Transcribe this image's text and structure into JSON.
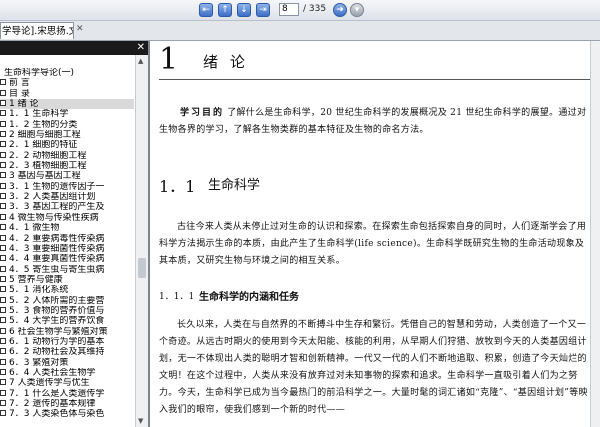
{
  "toolbar": {
    "page_value": "8",
    "page_total": "/ 335"
  },
  "tab": {
    "label": "学导论].宋思扬.文..."
  },
  "sidebar": {
    "items": [
      {
        "text": "生命科学导论(一)"
      },
      {
        "text": "前  言"
      },
      {
        "text": "目  录"
      },
      {
        "text": "1   绪  论"
      },
      {
        "text": "1．1  生命科学"
      },
      {
        "text": "1．2  生物的分类"
      },
      {
        "text": "2   细胞与细胞工程"
      },
      {
        "text": "2．1  细胞的特征"
      },
      {
        "text": "2．2  动物细胞工程"
      },
      {
        "text": "2．3  植物细胞工程"
      },
      {
        "text": "3   基因与基因工程"
      },
      {
        "text": "3．1  生物的遗传因子一"
      },
      {
        "text": "3．2  人类基因组计划"
      },
      {
        "text": "3．3  基因工程的产生及"
      },
      {
        "text": "4   微生物与传染性疾病"
      },
      {
        "text": "4．1  微生物"
      },
      {
        "text": "4．2  重要病毒性传染病"
      },
      {
        "text": "4．3  重要细菌性传染病"
      },
      {
        "text": "4．4  重要真菌性传染病"
      },
      {
        "text": "4．5  寄生虫与寄生虫病"
      },
      {
        "text": "5   营养与健康"
      },
      {
        "text": "5．1  消化系统"
      },
      {
        "text": "5．2  人体所需的主要营"
      },
      {
        "text": "5．3  食物的营养价值与"
      },
      {
        "text": "5．4  大学生的营养饮食"
      },
      {
        "text": "6   社会生物学与繁殖对策"
      },
      {
        "text": "6．1  动物行为学的基本"
      },
      {
        "text": "6．2  动物社会及其维持"
      },
      {
        "text": "6．3  繁殖对策"
      },
      {
        "text": "6．4  人类社会生物学"
      },
      {
        "text": "7   人类遗传学与优生"
      },
      {
        "text": "7．1  什么是人类遗传学"
      },
      {
        "text": "7．2  遗传的基本规律"
      },
      {
        "text": "7．3  人类染色体与染色"
      }
    ]
  },
  "document": {
    "chapter_number": "1",
    "chapter_title": "绪论",
    "goal_label": "学习目的",
    "goal_text": "了解什么是生命科学，20 世纪生命科学的发展概况及 21 世纪生命科学的展望。通过对生物各界的学习，了解各生物类群的基本特征及生物的命名方法。",
    "section_number": "1．1",
    "section_title": "生命科学",
    "section_para": "古往今来人类从未停止过对生命的认识和探索。在探索生命包括探索自身的同时，人们逐渐学会了用科学方法揭示生命的本质，由此产生了生命科学(life science)。生命科学既研究生物的生命活动现象及其本质，又研究生物与环境之间的相互关系。",
    "subsection_number": "1．1．1",
    "subsection_title": "生命科学的内涵和任务",
    "subsection_para": "长久以来，人类在与自然界的不断搏斗中生存和繁衍。凭借自己的智慧和劳动，人类创造了一个又一个奇迹。从远古时期火的使用到今天太阳能、核能的利用，从早期人们狩猎、放牧到今天的人类基因组计划，无一不体现出人类的聪明才智和创新精神。一代又一代的人们不断地追取、积累，创造了今天灿烂的文明！在这个过程中，人类从来没有放弃过对未知事物的探索和追求。生命科学一直吸引着人们为之努力。今天，生命科学已成为当今最热门的前沿科学之一。大量时髦的词汇诸如“克隆”、“基因组计划”等映入我们的眼帘，使我们感到一个新的时代——"
  }
}
